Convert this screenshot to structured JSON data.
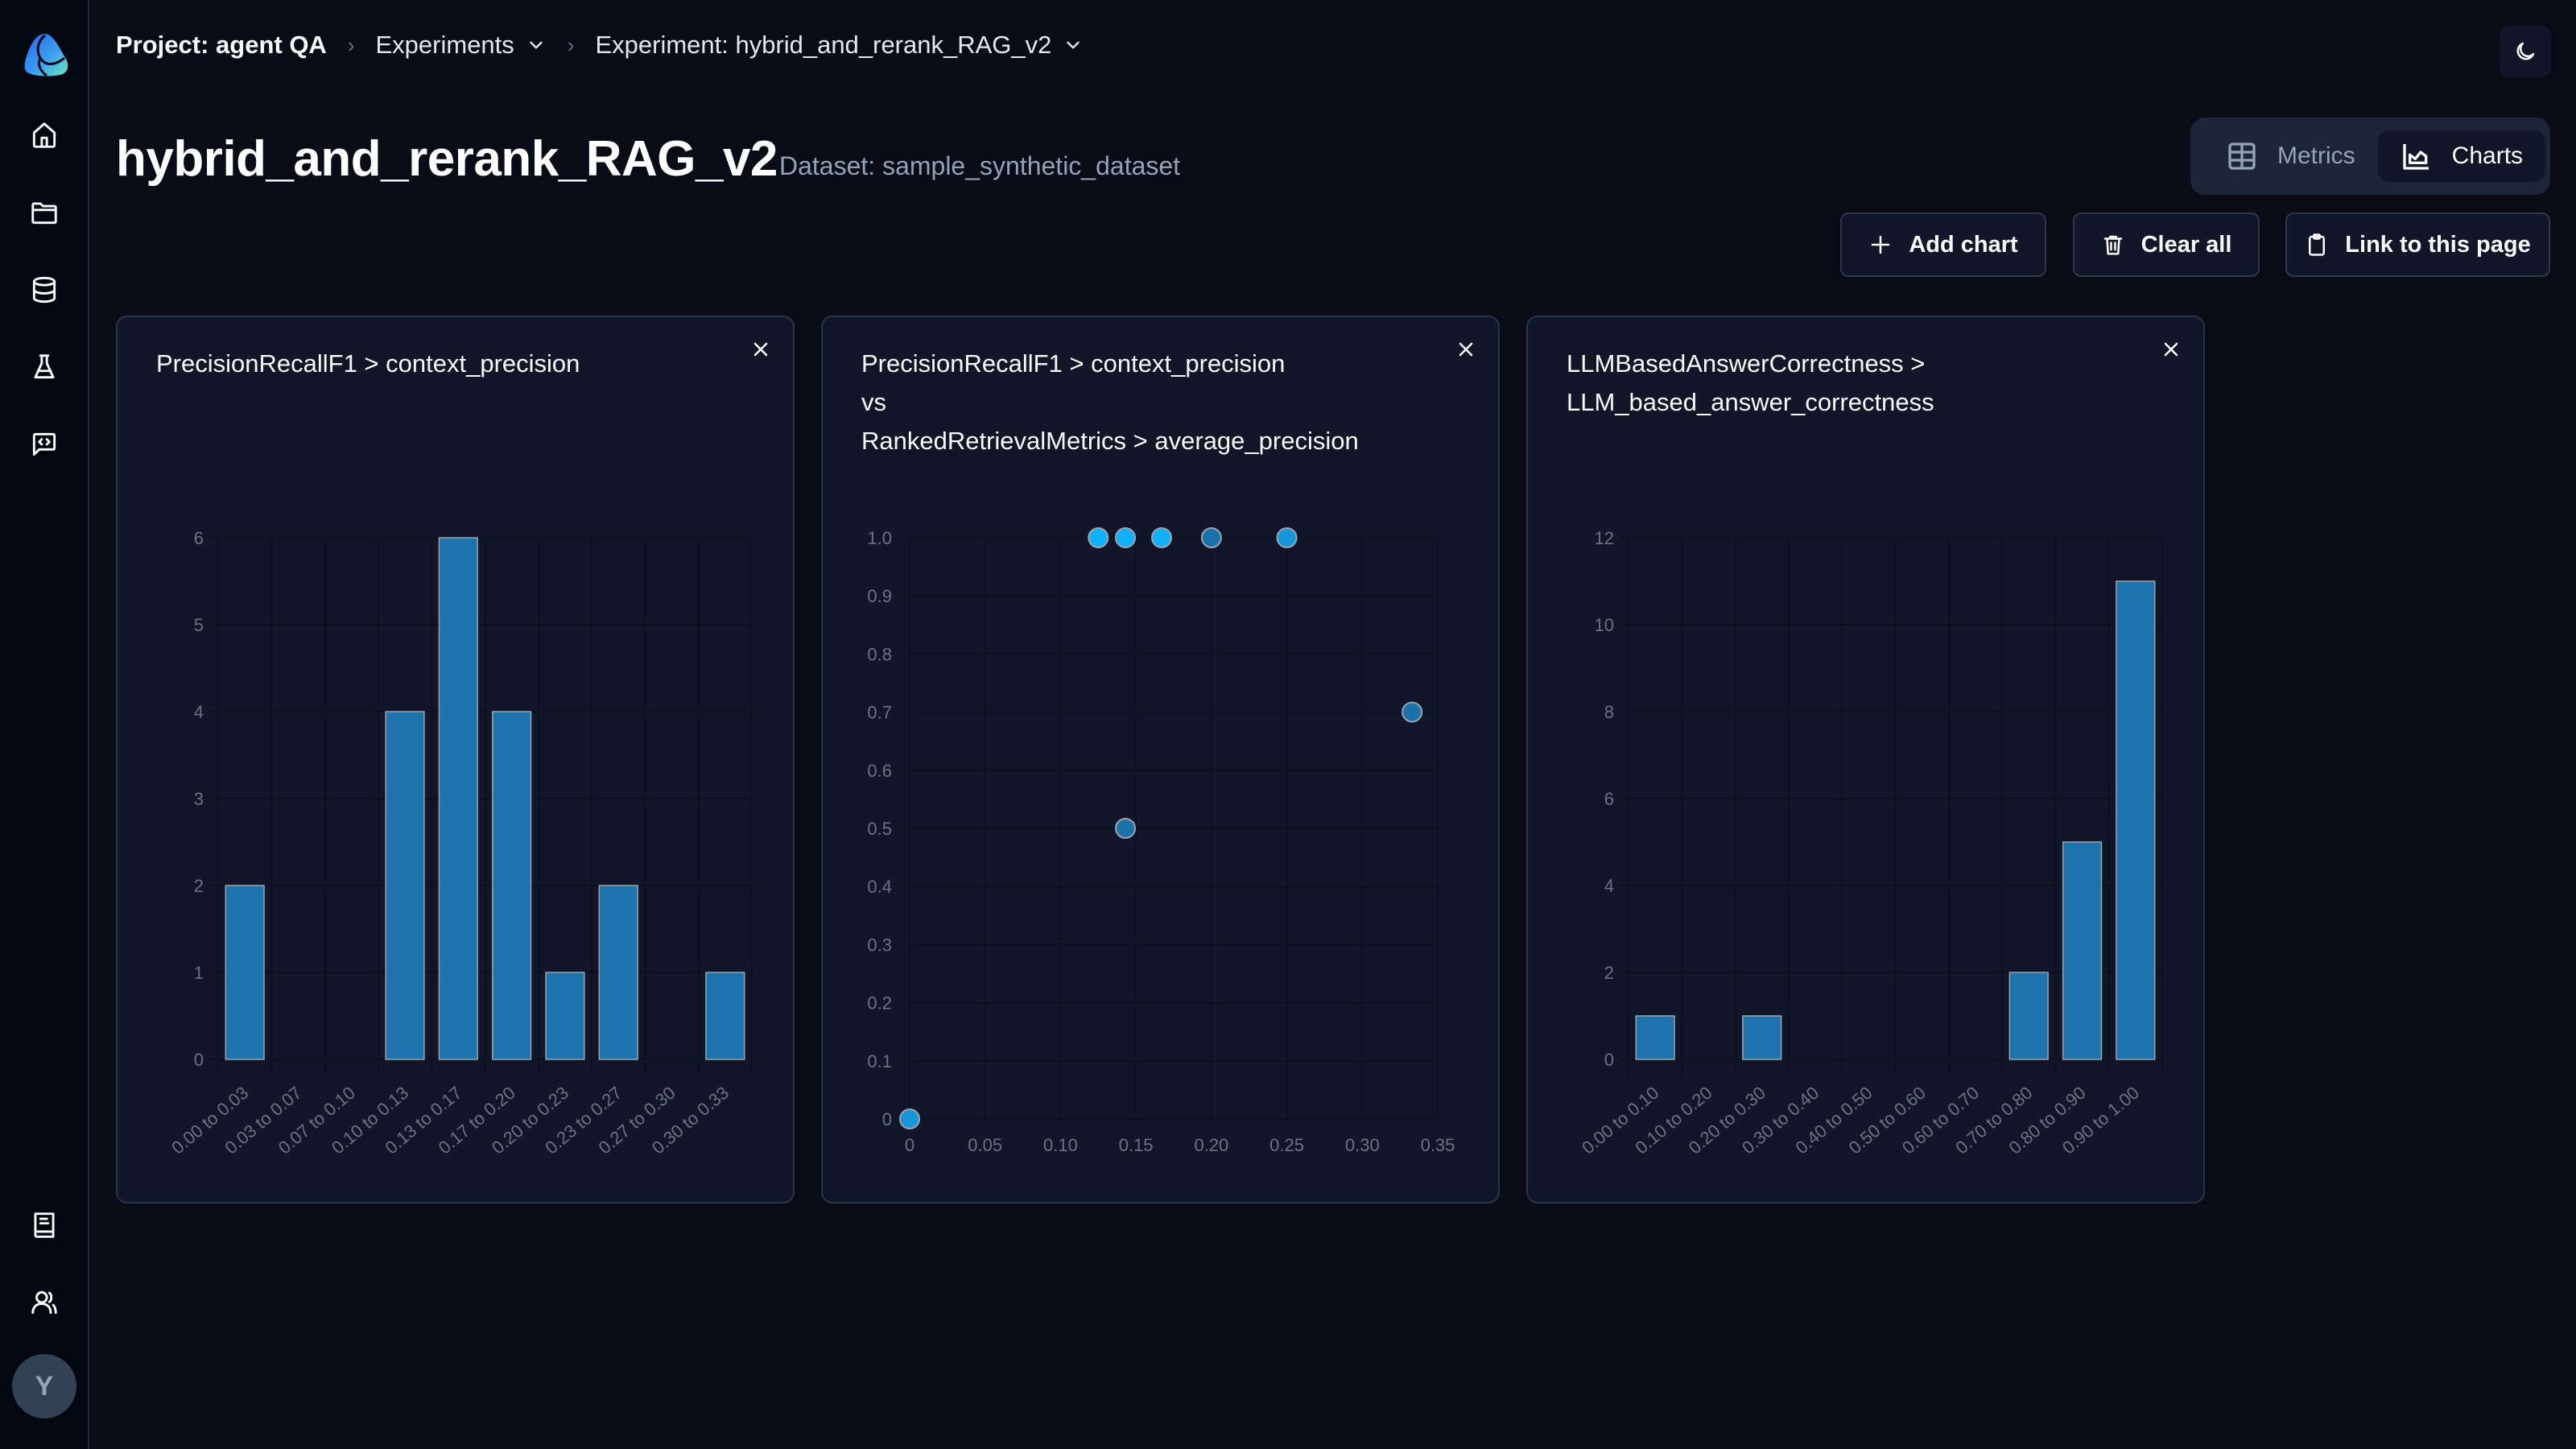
{
  "sidebar": {
    "top_items": [
      {
        "name": "home",
        "icon": "home-icon"
      },
      {
        "name": "projects",
        "icon": "folder-icon"
      },
      {
        "name": "datasets",
        "icon": "database-icon"
      },
      {
        "name": "experiments",
        "icon": "flask-icon"
      },
      {
        "name": "prompts",
        "icon": "code-message-icon"
      }
    ],
    "bottom_items": [
      {
        "name": "docs",
        "icon": "book-icon"
      },
      {
        "name": "team",
        "icon": "users-icon"
      }
    ],
    "avatar_initial": "Y"
  },
  "breadcrumb": {
    "project": "Project: agent QA",
    "experiments": "Experiments",
    "experiment": "Experiment: hybrid_and_rerank_RAG_v2"
  },
  "header": {
    "title": "hybrid_and_rerank_RAG_v2",
    "dataset": "Dataset: sample_synthetic_dataset"
  },
  "view_toggle": {
    "metrics": "Metrics",
    "charts": "Charts",
    "active": "charts"
  },
  "actions": {
    "add_chart": "Add chart",
    "clear_all": "Clear all",
    "link": "Link to this page"
  },
  "colors": {
    "bar_fill": "#1d74ad",
    "bar_stroke": "#9ca3af",
    "dot_single": "#1a72a8",
    "dot_overlap": "#0fb1ff",
    "dot_mid": "#1496d8"
  },
  "chart_data": [
    {
      "type": "bar",
      "title": "PrecisionRecallF1 > context_precision",
      "title_lines": [
        "PrecisionRecallF1 > context_precision"
      ],
      "categories": [
        "0.00 to 0.03",
        "0.03 to 0.07",
        "0.07 to 0.10",
        "0.10 to 0.13",
        "0.13 to 0.17",
        "0.17 to 0.20",
        "0.20 to 0.23",
        "0.23 to 0.27",
        "0.27 to 0.30",
        "0.30 to 0.33"
      ],
      "values": [
        2,
        0,
        0,
        4,
        6,
        4,
        1,
        2,
        0,
        1
      ],
      "xlabel": "",
      "ylabel": "",
      "ylim": [
        0,
        6
      ],
      "yticks": [
        0,
        1,
        2,
        3,
        4,
        5,
        6
      ],
      "grid": true
    },
    {
      "type": "scatter",
      "title": "PrecisionRecallF1 > context_precision vs RankedRetrievalMetrics > average_precision",
      "title_lines": [
        "PrecisionRecallF1 > context_precision",
        "vs",
        "RankedRetrievalMetrics > average_precision"
      ],
      "points": [
        {
          "x": 0,
          "y": 0,
          "tone": "mid"
        },
        {
          "x": 0.125,
          "y": 1.0,
          "tone": "overlap"
        },
        {
          "x": 0.143,
          "y": 1.0,
          "tone": "overlap"
        },
        {
          "x": 0.167,
          "y": 1.0,
          "tone": "overlap"
        },
        {
          "x": 0.2,
          "y": 1.0,
          "tone": "single"
        },
        {
          "x": 0.25,
          "y": 1.0,
          "tone": "mid"
        },
        {
          "x": 0.143,
          "y": 0.5,
          "tone": "single"
        },
        {
          "x": 0.333,
          "y": 0.7,
          "tone": "single"
        }
      ],
      "xlabel": "",
      "ylabel": "",
      "xlim": [
        0,
        0.35
      ],
      "ylim": [
        0,
        1.0
      ],
      "xticks": [
        "0",
        "0.05",
        "0.10",
        "0.15",
        "0.20",
        "0.25",
        "0.30",
        "0.35"
      ],
      "yticks": [
        "0",
        "0.1",
        "0.2",
        "0.3",
        "0.4",
        "0.5",
        "0.6",
        "0.7",
        "0.8",
        "0.9",
        "1.0"
      ],
      "grid": true
    },
    {
      "type": "bar",
      "title": "LLMBasedAnswerCorrectness > LLM_based_answer_correctness",
      "title_lines": [
        "LLMBasedAnswerCorrectness >",
        "LLM_based_answer_correctness"
      ],
      "categories": [
        "0.00 to 0.10",
        "0.10 to 0.20",
        "0.20 to 0.30",
        "0.30 to 0.40",
        "0.40 to 0.50",
        "0.50 to 0.60",
        "0.60 to 0.70",
        "0.70 to 0.80",
        "0.80 to 0.90",
        "0.90 to 1.00"
      ],
      "values": [
        1,
        0,
        1,
        0,
        0,
        0,
        0,
        2,
        5,
        11
      ],
      "xlabel": "",
      "ylabel": "",
      "ylim": [
        0,
        12
      ],
      "yticks": [
        0,
        2,
        4,
        6,
        8,
        10,
        12
      ],
      "grid": true
    }
  ]
}
